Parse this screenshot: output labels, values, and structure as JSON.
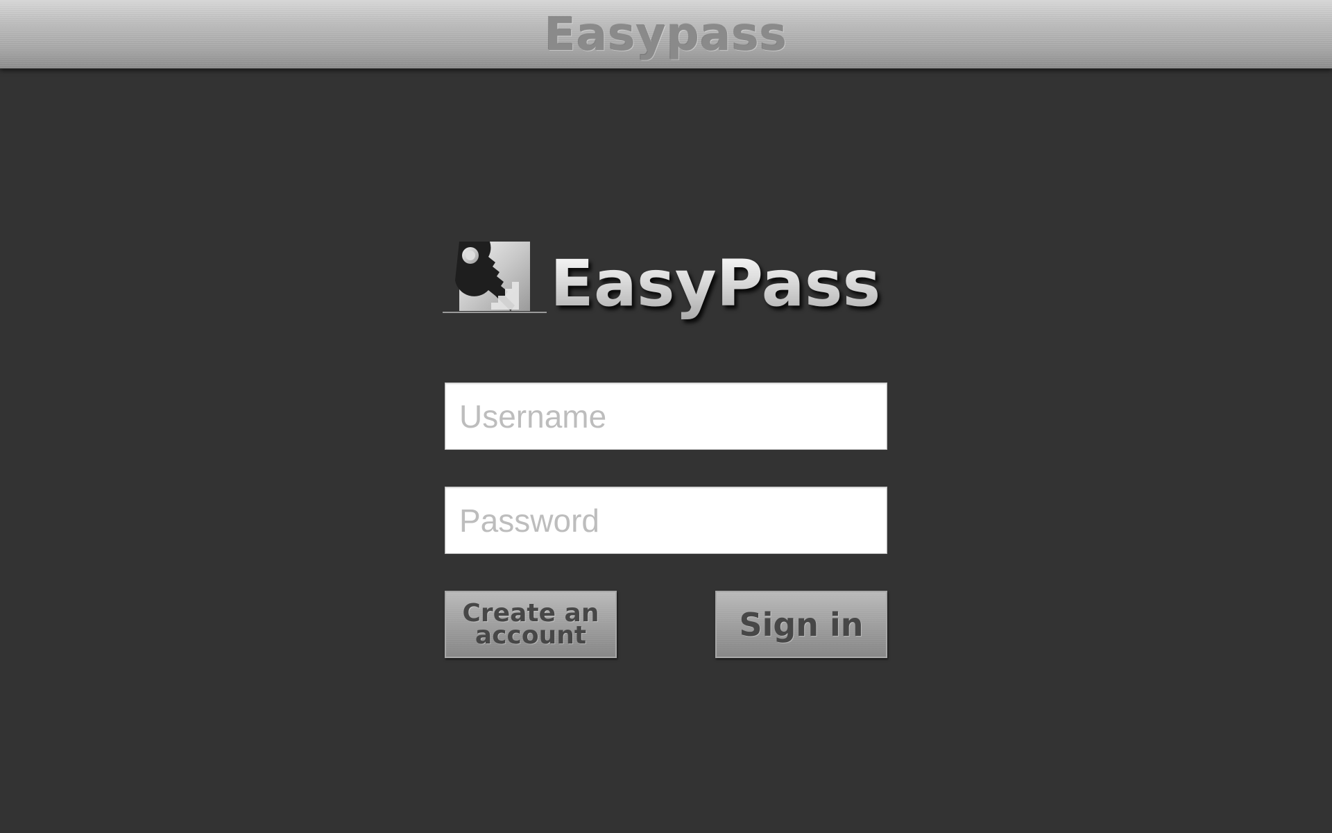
{
  "window": {
    "title": "Easypass"
  },
  "logo": {
    "text": "EasyPass",
    "icon": "key-staircase-icon"
  },
  "form": {
    "username": {
      "placeholder": "Username",
      "value": ""
    },
    "password": {
      "placeholder": "Password",
      "value": ""
    }
  },
  "buttons": {
    "create_account_label": "Create an account",
    "sign_in_label": "Sign in"
  },
  "colors": {
    "background": "#333333",
    "titlebar": "#b5b5b5",
    "title_text": "#8a8a8a",
    "button_text": "#474747"
  }
}
